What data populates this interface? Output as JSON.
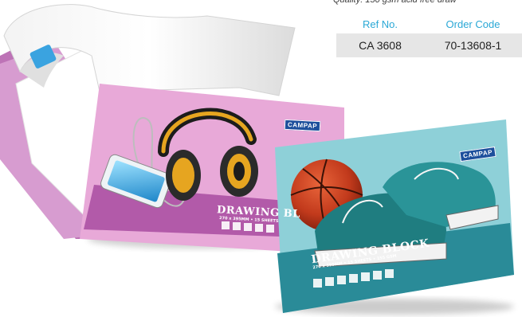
{
  "spec": {
    "top_text": "Quality: 150 gsm acid free draw",
    "columns": [
      "Ref No.",
      "Order Code"
    ],
    "rows": [
      [
        "CA 3608",
        "70-13608-1"
      ]
    ]
  },
  "pads": {
    "pink": {
      "brand": "CAMPAP",
      "title": "DRAWING BL",
      "subtitle": "270 x 395MM • 15 SHEETS"
    },
    "teal": {
      "brand": "CAMPAP",
      "title": "DRAWING BLOCK",
      "subtitle": "270 x 395MM • 15 SHEETS • 155 GSM"
    }
  },
  "colors": {
    "ref_header": "#2aa8d6",
    "row_bg": "#e6e6e6",
    "pink_pad": "#e8a9d8",
    "pink_band": "#b25aa9",
    "teal_pad": "#8ed0d8",
    "teal_band": "#2a8b98"
  }
}
